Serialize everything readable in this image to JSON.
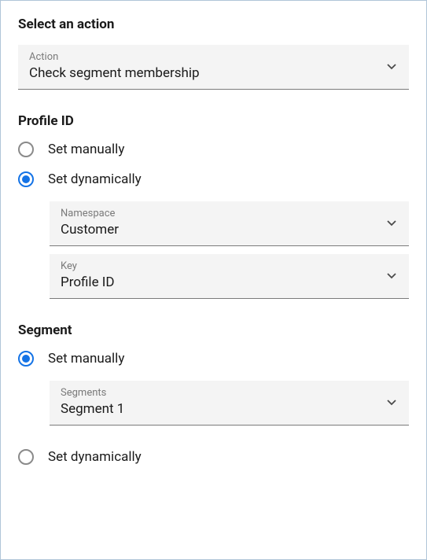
{
  "action_section": {
    "title": "Select an action",
    "select": {
      "label": "Action",
      "value": "Check segment membership"
    }
  },
  "profile_section": {
    "title": "Profile ID",
    "radio_manual": "Set manually",
    "radio_dynamic": "Set dynamically",
    "selected": "dynamic",
    "namespace_select": {
      "label": "Namespace",
      "value": "Customer"
    },
    "key_select": {
      "label": "Key",
      "value": "Profile ID"
    }
  },
  "segment_section": {
    "title": "Segment",
    "radio_manual": "Set manually",
    "radio_dynamic": "Set dynamically",
    "selected": "manual",
    "segments_select": {
      "label": "Segments",
      "value": "Segment 1"
    }
  }
}
